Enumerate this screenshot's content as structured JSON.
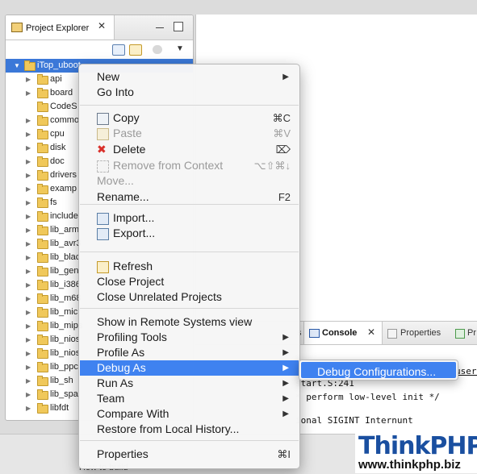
{
  "explorer": {
    "title": "Project Explorer",
    "close_glyph": "✕",
    "root_label": "iTop_uboot",
    "items": [
      {
        "label": "api",
        "expandable": true
      },
      {
        "label": "board",
        "expandable": true
      },
      {
        "label": "CodeS",
        "expandable": false
      },
      {
        "label": "commo",
        "expandable": true
      },
      {
        "label": "cpu",
        "expandable": true
      },
      {
        "label": "disk",
        "expandable": true
      },
      {
        "label": "doc",
        "expandable": true
      },
      {
        "label": "drivers",
        "expandable": true
      },
      {
        "label": "examp",
        "expandable": true
      },
      {
        "label": "fs",
        "expandable": true
      },
      {
        "label": "include",
        "expandable": true
      },
      {
        "label": "lib_arm",
        "expandable": true
      },
      {
        "label": "lib_avr3",
        "expandable": true
      },
      {
        "label": "lib_blac",
        "expandable": true
      },
      {
        "label": "lib_gen",
        "expandable": true
      },
      {
        "label": "lib_i386",
        "expandable": true
      },
      {
        "label": "lib_m68",
        "expandable": true
      },
      {
        "label": "lib_micr",
        "expandable": true
      },
      {
        "label": "lib_mips",
        "expandable": true
      },
      {
        "label": "lib_nios",
        "expandable": true
      },
      {
        "label": "lib_nios",
        "expandable": true
      },
      {
        "label": "lib_ppc",
        "expandable": true
      },
      {
        "label": "lib_sh",
        "expandable": true
      },
      {
        "label": "lib_spa",
        "expandable": true
      },
      {
        "label": "libfdt",
        "expandable": true
      }
    ]
  },
  "console": {
    "tabs": [
      {
        "label": "s"
      },
      {
        "label": "Console"
      },
      {
        "label": "Properties"
      },
      {
        "label": "Pr"
      }
    ],
    "close_glyph": "✕",
    "lines": [
      "start.S:241",
      "* perform low-level init */",
      "",
      "ional SIGINT  Internunt"
    ],
    "users_fragment": "users"
  },
  "context_menu": {
    "items": [
      {
        "label": "New",
        "submenu": true
      },
      {
        "label": "Go Into"
      },
      {
        "sep": true
      },
      {
        "label": "Copy",
        "shortcut": "⌘C",
        "icon": "copy-icon"
      },
      {
        "label": "Paste",
        "shortcut": "⌘V",
        "icon": "paste-icon",
        "disabled": true
      },
      {
        "label": "Delete",
        "shortcut": "⌦",
        "icon": "delete-icon"
      },
      {
        "label": "Remove from Context",
        "shortcut": "⌥⇧⌘↓",
        "icon": "remove-context-icon",
        "disabled": true
      },
      {
        "label": "Move...",
        "disabled": true
      },
      {
        "label": "Rename...",
        "shortcut": "F2"
      },
      {
        "sep": true
      },
      {
        "label": "Import...",
        "icon": "import-icon"
      },
      {
        "label": "Export...",
        "icon": "export-icon"
      },
      {
        "sep": true
      },
      {
        "label": "Refresh",
        "icon": "refresh-icon"
      },
      {
        "label": "Close Project"
      },
      {
        "label": "Close Unrelated Projects"
      },
      {
        "sep": true
      },
      {
        "label": "Show in Remote Systems view"
      },
      {
        "label": "Profiling Tools",
        "submenu": true
      },
      {
        "label": "Profile As",
        "submenu": true
      },
      {
        "label": "Debug As",
        "submenu": true,
        "highlighted": true
      },
      {
        "label": "Run As",
        "submenu": true
      },
      {
        "label": "Team",
        "submenu": true
      },
      {
        "label": "Compare With",
        "submenu": true
      },
      {
        "label": "Restore from Local History..."
      },
      {
        "sep": true
      },
      {
        "label": "Properties",
        "shortcut": "⌘I"
      }
    ],
    "submenu_arrow": "▶"
  },
  "submenu": {
    "label": "Debug Configurations..."
  },
  "background_text": "How to build",
  "brand": {
    "logo": "ThinkPHP",
    "url": "www.thinkphp.biz"
  },
  "colors": {
    "selection": "#3b78d8",
    "menu_highlight": "#3f82f0",
    "delete_red": "#d9302b"
  }
}
